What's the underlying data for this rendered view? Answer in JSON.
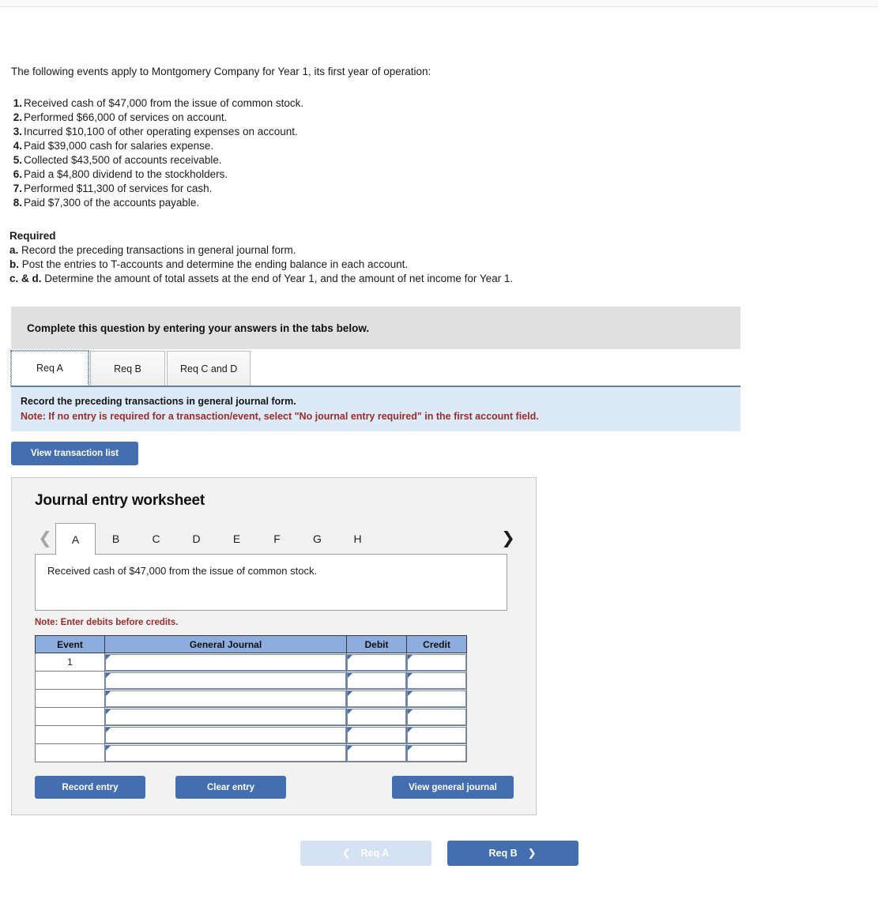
{
  "intro": "The following events apply to Montgomery Company for Year 1, its first year of operation:",
  "events": [
    {
      "num": "1.",
      "text": "Received cash of $47,000 from the issue of common stock."
    },
    {
      "num": "2.",
      "text": "Performed $66,000 of services on account."
    },
    {
      "num": "3.",
      "text": "Incurred $10,100 of other operating expenses on account."
    },
    {
      "num": "4.",
      "text": "Paid $39,000 cash for salaries expense."
    },
    {
      "num": "5.",
      "text": "Collected $43,500 of accounts receivable."
    },
    {
      "num": "6.",
      "text": "Paid a $4,800 dividend to the stockholders."
    },
    {
      "num": "7.",
      "text": "Performed $11,300 of services for cash."
    },
    {
      "num": "8.",
      "text": "Paid $7,300 of the accounts payable."
    }
  ],
  "required": {
    "title": "Required",
    "items": [
      {
        "label": "a.",
        "text": "Record the preceding transactions in general journal form."
      },
      {
        "label": "b.",
        "text": "Post the entries to T-accounts and determine the ending balance in each account."
      },
      {
        "label": "c. & d.",
        "text": "Determine the amount of total assets at the end of Year 1, and the amount of net income for Year 1."
      }
    ]
  },
  "banner": {
    "text": "Complete this question by entering your answers in the tabs below."
  },
  "req_tabs": [
    {
      "label": "Req A",
      "active": true
    },
    {
      "label": "Req B",
      "active": false
    },
    {
      "label": "Req C and D",
      "active": false
    }
  ],
  "instruction": {
    "line1": "Record the preceding transactions in general journal form.",
    "note": "Note: If no entry is required for a transaction/event, select \"No journal entry required\" in the first account field."
  },
  "view_transaction_list_label": "View transaction list",
  "worksheet": {
    "title": "Journal entry worksheet",
    "prev_icon": "chevron-left-icon",
    "next_icon": "chevron-right-icon",
    "letter_tabs": [
      {
        "label": "A",
        "active": true
      },
      {
        "label": "B",
        "active": false
      },
      {
        "label": "C",
        "active": false
      },
      {
        "label": "D",
        "active": false
      },
      {
        "label": "E",
        "active": false
      },
      {
        "label": "F",
        "active": false
      },
      {
        "label": "G",
        "active": false
      },
      {
        "label": "H",
        "active": false
      }
    ],
    "description": "Received cash of $47,000 from the issue of common stock.",
    "note_debits": "Note: Enter debits before credits.",
    "table": {
      "headers": [
        "Event",
        "General Journal",
        "Debit",
        "Credit"
      ],
      "rows": [
        {
          "event": "1",
          "general_journal": "",
          "debit": "",
          "credit": ""
        },
        {
          "event": "",
          "general_journal": "",
          "debit": "",
          "credit": ""
        },
        {
          "event": "",
          "general_journal": "",
          "debit": "",
          "credit": ""
        },
        {
          "event": "",
          "general_journal": "",
          "debit": "",
          "credit": ""
        },
        {
          "event": "",
          "general_journal": "",
          "debit": "",
          "credit": ""
        },
        {
          "event": "",
          "general_journal": "",
          "debit": "",
          "credit": ""
        }
      ]
    },
    "buttons": {
      "record": "Record entry",
      "clear": "Clear entry",
      "view_general_journal": "View general journal"
    }
  },
  "bottom_nav": {
    "prev_label": "Req A",
    "prev_icon": "chevron-left-icon",
    "next_label": "Req B",
    "next_icon": "chevron-right-icon"
  },
  "colors": {
    "accent_blue": "#436fb0",
    "banner_gray": "#e0e0e0",
    "instruction_blue": "#dceaf7",
    "note_red": "#9e2b2b",
    "table_header_blue": "#8cadde",
    "disabled_blue": "#d4e2f2"
  }
}
